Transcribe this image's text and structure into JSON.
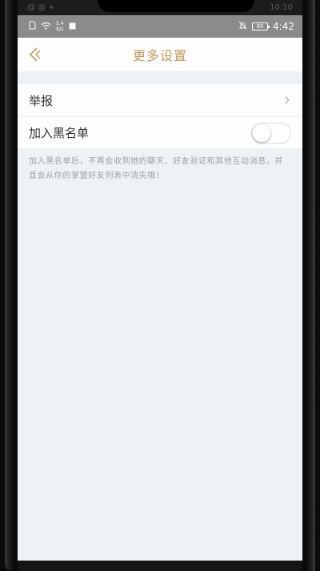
{
  "ghost_status": {
    "left": "@ @ +",
    "right": "10:10"
  },
  "statusbar": {
    "netspeed_value": "5.4",
    "netspeed_unit": "K/s",
    "left_icons": [
      "sim-icon",
      "wifi-icon",
      "image-icon"
    ],
    "right_icons": [
      "mute-bell-icon",
      "battery-icon"
    ],
    "battery_level": "80",
    "time": "4:42"
  },
  "navbar": {
    "title": "更多设置",
    "back_icon": "chevron-left-icon"
  },
  "settings": {
    "report_label": "举报",
    "blacklist_label": "加入黑名单",
    "blacklist_enabled": false
  },
  "hint": "加入黑名单后，不再会收到她的聊天、好友验证和其他互动消息，并且会从你的掌盟好友列表中消失哦！",
  "colors": {
    "accent": "#c09a63",
    "statusbar": "#8b8b8b",
    "background": "#eef2f4"
  }
}
